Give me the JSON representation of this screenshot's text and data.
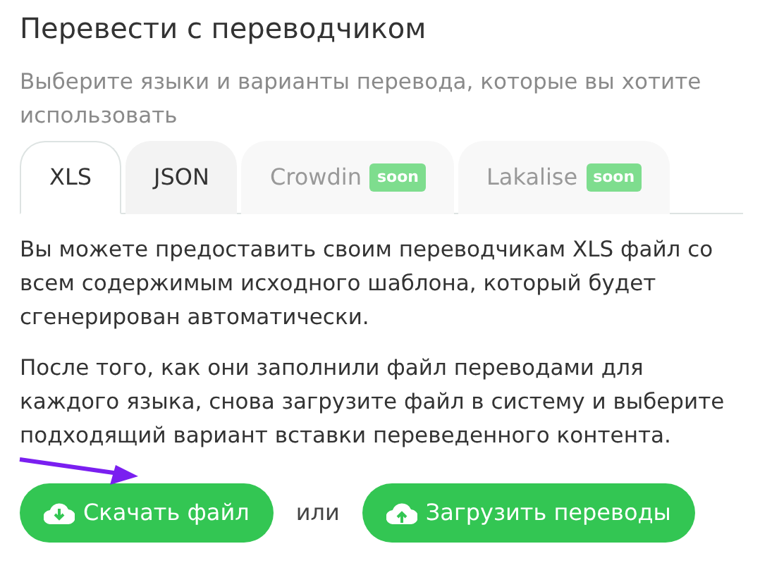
{
  "title": "Перевести с переводчиком",
  "subtitle": "Выберите языки и варианты перевода, которые вы хотите использовать",
  "tabs": [
    {
      "label": "XLS",
      "selected": true,
      "disabled": false
    },
    {
      "label": "JSON",
      "selected": false,
      "disabled": false
    },
    {
      "label": "Crowdin",
      "selected": false,
      "disabled": true,
      "badge": "soon"
    },
    {
      "label": "Lakalise",
      "selected": false,
      "disabled": true,
      "badge": "soon"
    }
  ],
  "paragraphs": [
    "Вы можете предоставить своим переводчикам XLS файл со всем содержимым исходного шаблона, который будет сгенерирован автоматически.",
    "После того, как они заполнили файл переводами для каждого языка, снова загрузите файл в систему и выберите подходящий вариант вставки переведенного контента."
  ],
  "actions": [
    {
      "kind": "download",
      "label": "Скачать файл"
    },
    {
      "kind": "separator",
      "label": "или"
    },
    {
      "kind": "upload",
      "label": "Загрузить переводы"
    }
  ],
  "annotation": {
    "kind": "arrow",
    "color": "#7a1ff0"
  }
}
